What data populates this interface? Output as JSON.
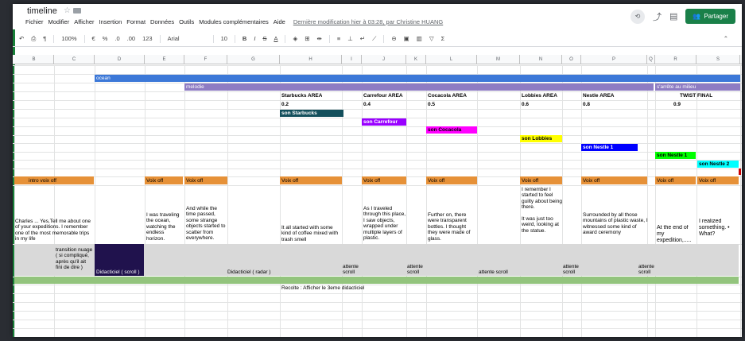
{
  "app": {
    "doc_title": "timeline",
    "menus": [
      "Fichier",
      "Modifier",
      "Afficher",
      "Insertion",
      "Format",
      "Données",
      "Outils",
      "Modules complémentaires",
      "Aide"
    ],
    "last_modified": "Dernière modification hier à 03:28, par Christine HUANG",
    "share_label": "Partager"
  },
  "toolbar": {
    "zoom": "100%",
    "currency": "€",
    "percent": "%",
    "dec_less": ".0",
    "dec_more": ".00",
    "format123": "123",
    "font": "Arial",
    "font_size": "10",
    "bold": "B",
    "italic": "I",
    "strike": "S",
    "textcolor": "A",
    "sigma": "Σ"
  },
  "columns": [
    "B",
    "C",
    "D",
    "E",
    "F",
    "G",
    "H",
    "I",
    "J",
    "K",
    "L",
    "M",
    "N",
    "O",
    "P",
    "Q",
    "R",
    "S"
  ],
  "rows": {
    "ocean": "ocean",
    "melodie": "melodie",
    "sarrete": "s'arrête au milieu",
    "areas": [
      "Starbucks AREA",
      "Carrefour AREA",
      "Cocacola AREA",
      "Lobbies AREA",
      "Nestle AREA",
      "TWIST FINAL"
    ],
    "area_nums": [
      "0.2",
      "0.4",
      "0.5",
      "0.6",
      "0.8",
      "0.9"
    ],
    "sons": [
      "son Starbucks",
      "son Carrefour",
      "son Cocacola",
      "son Lobbies",
      "son Nestle 1",
      "son Nestle 1",
      "son Nestle 2"
    ],
    "voix": [
      "intro voix off",
      "Voix off",
      "Voix off",
      "Voix off",
      "Voix off",
      "Voix off",
      "Voix off",
      "Voix off",
      "Voix off",
      "Voix off"
    ],
    "texts": [
      "Charles ...  Yes,Tell me about one of your expeditions. I remember one of the most memorable trips in my life",
      "I was traveling the ocean, watching the endless horizon.",
      "And while the time passed, some strange objects started to scatter from everywhere.",
      "It all started with some kind of coffee mixed with trash smell",
      "As I traveled through this place, I saw objects, wrapped under multiple layers of plastic.",
      "Further on, there were transparent bottles. I thought they were made of glass.",
      "I remember I started to feel guilty about being there.\n\nIt was just too weird, looking at the statue.",
      "Surrounded by all those mountains of plastic waste, I witnessed some kind of award ceremony",
      "At the end of my expedition,.....",
      "I realized something. • What?"
    ],
    "didactic": {
      "transition": "transition nuage ( si compliqué, après qu'il ait fini de dire )",
      "scroll_tut": "Didacticiel ( scroll )",
      "radar_tut": "Didacticiel ( radar )",
      "attente": [
        "attente scroll",
        "attente scroll",
        "attente scroll",
        "attente scroll",
        "attente scroll"
      ]
    },
    "recolte": "Recolte : Afficher le 3eme didacticiel"
  },
  "colors": {
    "ocean": "#3c78d8",
    "melodie": "#8e7cc3",
    "starbucks": "#134f5c",
    "carrefour": "#9900ff",
    "cocacola": "#ff00ff",
    "lobbies": "#ffff00",
    "nestle1": "#0000ff",
    "nestle1b": "#00ff00",
    "nestle2": "#00ffff",
    "voix": "#e69138",
    "green": "#93c47d",
    "navy": "#20124d"
  }
}
